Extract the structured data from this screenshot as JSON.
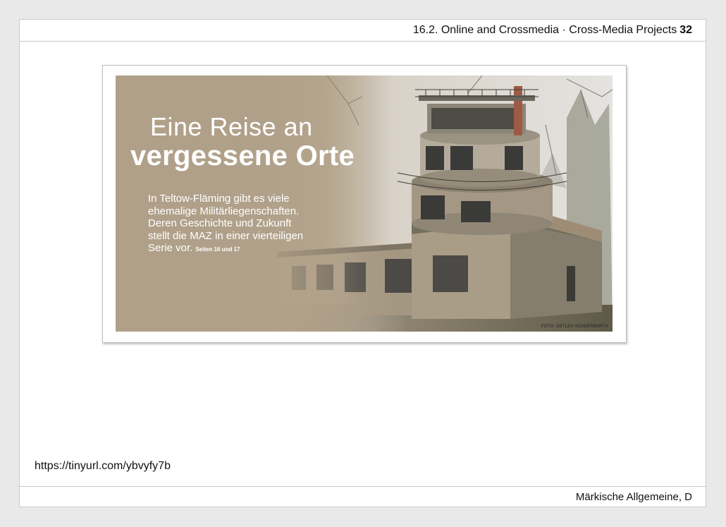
{
  "header": {
    "section": "16.2. Online and Crossmedia · Cross-Media Projects",
    "page_number": "32"
  },
  "clipping": {
    "headline_light": "Eine Reise an",
    "headline_bold": "vergessene Orte",
    "teaser_lines": [
      "In Teltow-Fläming gibt es viele",
      "ehemalige Militärliegenschaften.",
      "Deren Geschichte und Zukunft",
      "stellt die MAZ in einer vierteiligen",
      "Serie vor."
    ],
    "pages_ref": "Seiten 16 und 17",
    "photo_credit": "FOTO: DETLEV SCHEERBARTH"
  },
  "url": "https://tinyurl.com/ybvyfy7b",
  "footer": {
    "source": "Märkische Allgemeine, D"
  }
}
